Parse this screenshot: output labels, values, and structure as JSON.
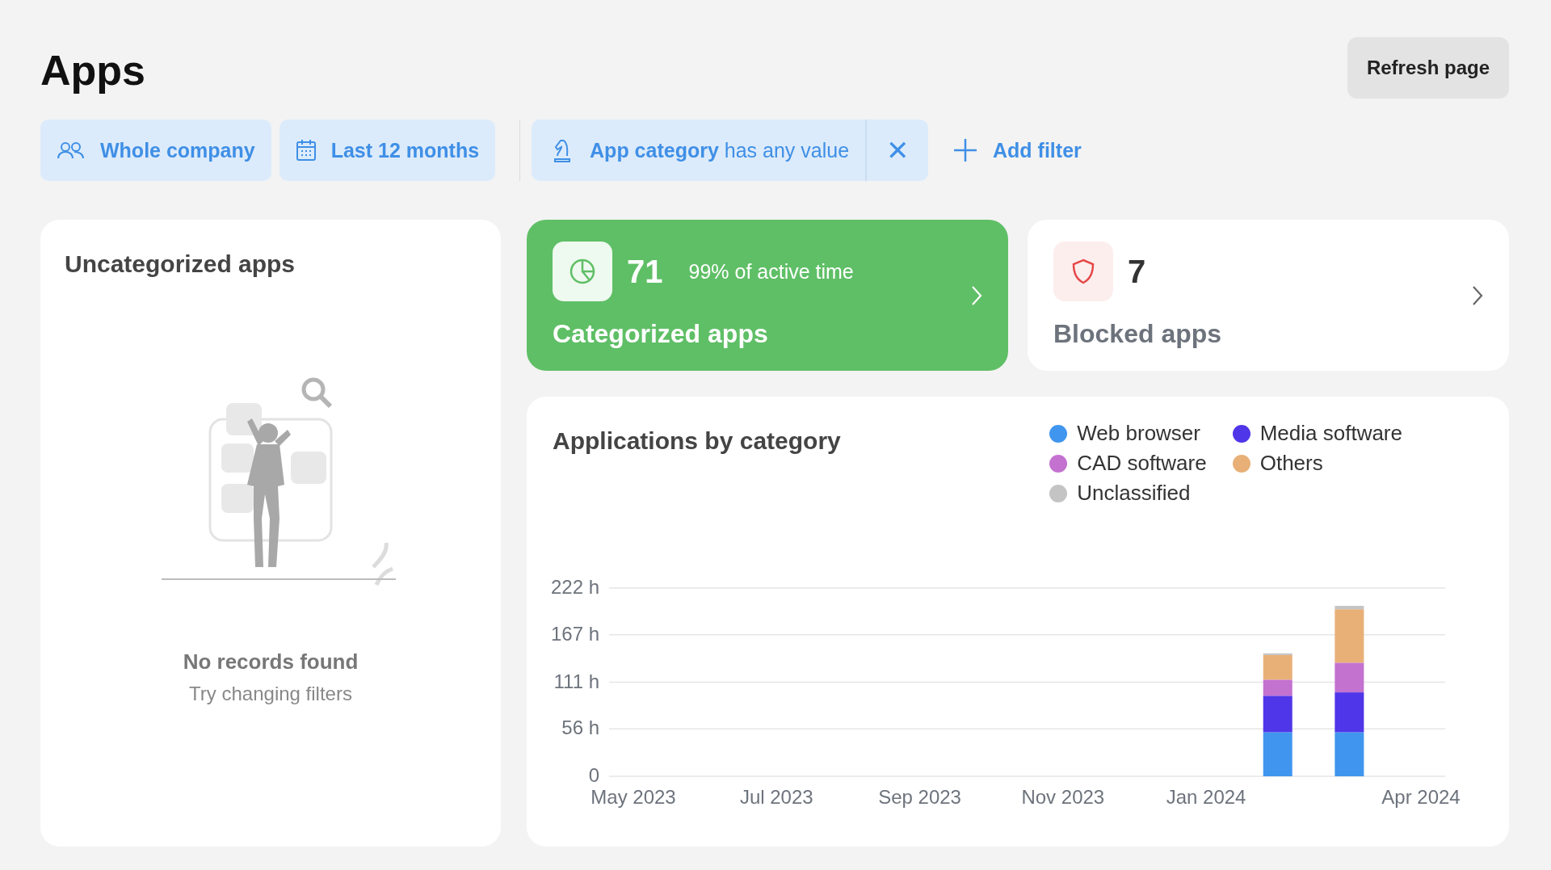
{
  "page": {
    "title": "Apps",
    "refresh_button": "Refresh page"
  },
  "filters": [
    {
      "kind": "people",
      "label": "Whole company"
    },
    {
      "kind": "calendar",
      "label": "Last 12 months"
    }
  ],
  "condition_filter": {
    "field": "App category",
    "condition": "has any value",
    "remove_icon": "✕"
  },
  "add_filter": "Add filter",
  "uncategorized": {
    "title": "Uncategorized apps",
    "empty_title": "No records found",
    "empty_hint": "Try changing filters"
  },
  "stat_cards": [
    {
      "kind": "categorized",
      "count": "71",
      "note": "99% of active time",
      "label": "Categorized apps"
    },
    {
      "kind": "blocked",
      "count": "7",
      "label": "Blocked apps"
    }
  ],
  "chart_card": {
    "title": "Applications by category",
    "chart_data": {
      "type": "bar",
      "stacked": true,
      "grid": true,
      "categories": [
        "May 2023",
        null,
        "Jul 2023",
        null,
        "Sep 2023",
        null,
        "Nov 2023",
        null,
        "Jan 2024",
        null,
        null,
        "Apr 2024"
      ],
      "series": [
        {
          "name": "Web browser",
          "color": "#4096ee",
          "values": [
            null,
            null,
            null,
            null,
            null,
            null,
            null,
            null,
            null,
            52,
            52,
            null
          ]
        },
        {
          "name": "Media software",
          "color": "#4f36e8",
          "values": [
            null,
            null,
            null,
            null,
            null,
            null,
            null,
            null,
            null,
            43,
            47,
            null
          ]
        },
        {
          "name": "CAD software",
          "color": "#c372d0",
          "values": [
            null,
            null,
            null,
            null,
            null,
            null,
            null,
            null,
            null,
            19,
            35,
            null
          ]
        },
        {
          "name": "Others",
          "color": "#e8b077",
          "values": [
            null,
            null,
            null,
            null,
            null,
            null,
            null,
            null,
            null,
            29,
            63,
            null
          ]
        },
        {
          "name": "Unclassified",
          "color": "#c4c4c4",
          "values": [
            null,
            null,
            null,
            null,
            null,
            null,
            null,
            null,
            null,
            2,
            4,
            null
          ]
        }
      ],
      "ylim": [
        0,
        222
      ],
      "yticks": [
        {
          "value": 0,
          "label": "0"
        },
        {
          "value": 56,
          "label": "56 h"
        },
        {
          "value": 111,
          "label": "111 h"
        },
        {
          "value": 167,
          "label": "167 h"
        },
        {
          "value": 222,
          "label": "222 h"
        }
      ]
    }
  }
}
